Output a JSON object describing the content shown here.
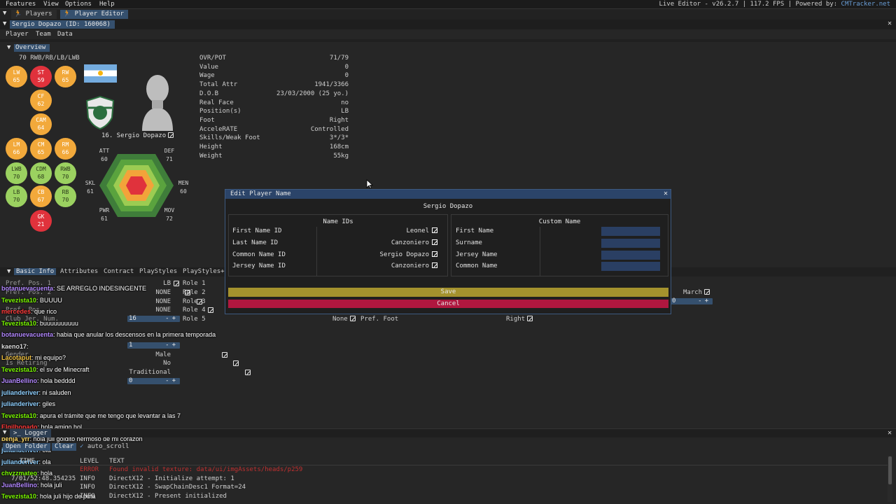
{
  "menubar": {
    "items": [
      "Features",
      "View",
      "Options",
      "Help"
    ],
    "status": "Live Editor - v26.2.7 | 117.2 FPS | Powered by: ",
    "status_link": "CMTracker.net"
  },
  "tabs": [
    {
      "label": "Players"
    },
    {
      "label": "Player Editor"
    }
  ],
  "window": {
    "title": "Sergio Dopazo (ID: 160068)",
    "subtabs": [
      "Player",
      "Team",
      "Data"
    ]
  },
  "overview": {
    "header": "Overview",
    "positions_label": "70 RWB/RB/LB/LWB",
    "positions": [
      {
        "pos": "LW",
        "rating": "65"
      },
      {
        "pos": "ST",
        "rating": "59"
      },
      {
        "pos": "RW",
        "rating": "65"
      },
      {
        "pos": "CF",
        "rating": "62"
      },
      {
        "pos": "CAM",
        "rating": "64"
      },
      {
        "pos": "LM",
        "rating": "66"
      },
      {
        "pos": "CM",
        "rating": "65"
      },
      {
        "pos": "RM",
        "rating": "66"
      },
      {
        "pos": "LWB",
        "rating": "70"
      },
      {
        "pos": "CDM",
        "rating": "68"
      },
      {
        "pos": "RWB",
        "rating": "70"
      },
      {
        "pos": "LB",
        "rating": "70"
      },
      {
        "pos": "CB",
        "rating": "67"
      },
      {
        "pos": "RB",
        "rating": "70"
      },
      {
        "pos": "GK",
        "rating": "21"
      }
    ],
    "player_display_name": "16. Sergio Dopazo",
    "hex_stats": [
      {
        "label": "ATT",
        "value": "60"
      },
      {
        "label": "DEF",
        "value": "71"
      },
      {
        "label": "MEN",
        "value": "60"
      },
      {
        "label": "MOV",
        "value": "72"
      },
      {
        "label": "PWR",
        "value": "61"
      },
      {
        "label": "SKL",
        "value": "61"
      }
    ],
    "details": [
      {
        "label": "OVR/POT",
        "value": "71/79"
      },
      {
        "label": "Value",
        "value": "0"
      },
      {
        "label": "Wage",
        "value": "0"
      },
      {
        "label": "Total Attr",
        "value": "1941/3366"
      },
      {
        "label": "D.O.B",
        "value": "23/03/2000 (25 yo.)"
      },
      {
        "label": "Real Face",
        "value": "no"
      },
      {
        "label": "Position(s)",
        "value": "LB"
      },
      {
        "label": "Foot",
        "value": "Right"
      },
      {
        "label": "AcceleRATE",
        "value": "Controlled"
      },
      {
        "label": "Skills/Weak Foot",
        "value": "3*/3*"
      },
      {
        "label": "Height",
        "value": "168cm"
      },
      {
        "label": "Weight",
        "value": "55kg"
      }
    ]
  },
  "bottom_tabs": [
    "Basic Info",
    "Attributes",
    "Contract",
    "PlayStyles",
    "PlayStyles+"
  ],
  "basic_info": {
    "pref_pos_1_label": "Pref. Pos. 1",
    "pref_pos_1_value": "LB",
    "pref_pos_2_label": "Pref. Pos. 2",
    "pref_pos_2_value": "NONE",
    "pref_pos_3_value": "NONE",
    "pref_pos_3_label": "Pref. Pos.",
    "pref_pos_4_value": "NONE",
    "club_jer_label": "Club Jer. Num.",
    "club_jer_value": "16",
    "role_labels": [
      "Role 1",
      "Role 2",
      "Role 3",
      "Role 4",
      "Role 5"
    ],
    "role5_value": "None",
    "pref_foot_label": "Pref. Foot",
    "pref_foot_value": "Right",
    "stepper2_value": "1",
    "gender_label": "Gender",
    "gender_value": "Male",
    "retiring_label": "Is Retiring",
    "retiring_value": "No",
    "traditional_value": "Traditional",
    "stepper3_value": "0",
    "birth_month_value": "March",
    "stepper_right_value": "0"
  },
  "chat": [
    {
      "user": "botanuevacuenta",
      "msg": ": SE ARREGLO INDESINGENTE",
      "color": "#b388ff"
    },
    {
      "user": "Tevezista10",
      "msg": ": BUUUU",
      "color": "#7cfc00"
    },
    {
      "user": "mercedes",
      "msg": ": que rico",
      "color": "#ff3b3b"
    },
    {
      "user": "Tevezista10",
      "msg": ": buuuuuuuuuu",
      "color": "#7cfc00"
    },
    {
      "user": "botanuevacuenta",
      "msg": ": habia que anular los descensos en la primera temporada",
      "color": "#b388ff"
    },
    {
      "user": "kaeno17",
      "msg": ":",
      "color": "#dddddd"
    },
    {
      "user": "Lacotaput",
      "msg": ": mi equipo?",
      "color": "#f0c040"
    },
    {
      "user": "Tevezista10",
      "msg": ": el sv de Minecraft",
      "color": "#7cfc00"
    },
    {
      "user": "JuanBellino",
      "msg": ": hola bedddd",
      "color": "#b388ff"
    },
    {
      "user": "julianderiver",
      "msg": ": ni saluden",
      "color": "#8fd0ff"
    },
    {
      "user": "julianderiver",
      "msg": ": giles",
      "color": "#8fd0ff"
    },
    {
      "user": "Tevezista10",
      "msg": ": apura el trámite que me tengo que levantar a las 7",
      "color": "#7cfc00"
    },
    {
      "user": "Elgilbonado",
      "msg": ": hola amigo hol",
      "color": "#ff3b3b"
    },
    {
      "user": "benja_yrr",
      "msg": ": hola juli goldito hermoso de mi corazon",
      "color": "#ffd966"
    },
    {
      "user": "julianderiver",
      "msg": ": ola",
      "color": "#8fd0ff"
    },
    {
      "user": "julianderiver",
      "msg": ": ola",
      "color": "#8fd0ff"
    },
    {
      "user": "chvzzmateo",
      "msg": ": hola",
      "color": "#7cfc00"
    },
    {
      "user": "JuanBellino",
      "msg": ": hola juli",
      "color": "#b388ff"
    },
    {
      "user": "Tevezista10",
      "msg": ": hola juli hijo de puta",
      "color": "#7cfc00"
    }
  ],
  "logger": {
    "title": "Logger",
    "open_folder": "Open Folder",
    "clear": "Clear",
    "auto_scroll": "auto_scroll",
    "columns": [
      "TIME",
      "LEVEL",
      "TEXT"
    ],
    "rows": [
      {
        "time": "",
        "level": "ERROR",
        "text": "Found invalid texture: data/ui/imgAssets/heads/p259",
        "color": "#c03030"
      },
      {
        "time": "7/01/52:48.354235",
        "level": "INFO",
        "text": "DirectX12 - Initialize attempt: 1",
        "color": "#cfcfcf"
      },
      {
        "time": "",
        "level": "INFO",
        "text": "DirectX12 - SwapChainDesc1 Format=24",
        "color": "#cfcfcf"
      },
      {
        "time": "",
        "level": "INFO",
        "text": "DirectX12 - Present initialized",
        "color": "#cfcfcf"
      }
    ]
  },
  "modal": {
    "title": "Edit Player Name",
    "subtitle": "Sergio Dopazo",
    "name_ids_header": "Name IDs",
    "custom_name_header": "Custom Name",
    "name_ids": [
      {
        "label": "First Name ID",
        "value": "Leonel"
      },
      {
        "label": "Last Name ID",
        "value": "Canzoniero"
      },
      {
        "label": "Common Name ID",
        "value": "Sergio Dopazo"
      },
      {
        "label": "Jersey Name ID",
        "value": "Canzoniero"
      }
    ],
    "custom_fields": [
      "First Name",
      "Surname",
      "Jersey Name",
      "Common Name"
    ],
    "save_label": "Save",
    "cancel_label": "Cancel"
  },
  "colors": {
    "accent": "#35506e",
    "save": "#a4922d",
    "cancel": "#b0173f"
  }
}
